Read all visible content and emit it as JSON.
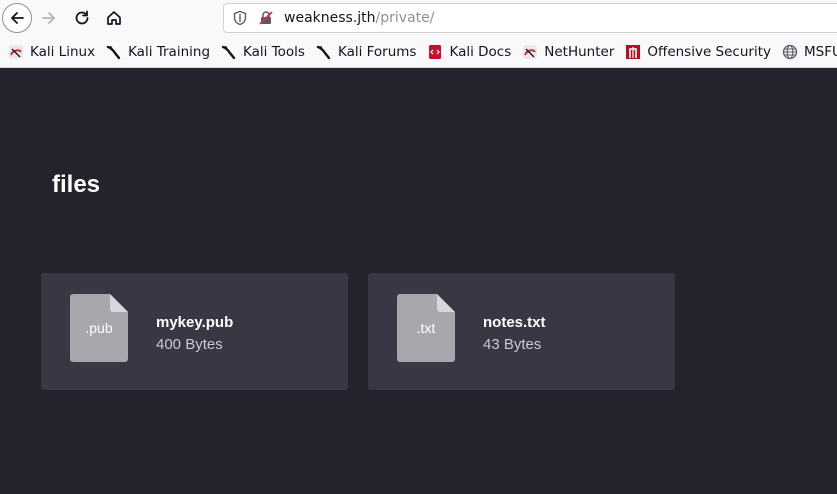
{
  "browser": {
    "url_host": "weakness.jth",
    "url_path": "/private/"
  },
  "bookmarks": [
    {
      "label": "Kali Linux",
      "icon": "kali-linux-icon"
    },
    {
      "label": "Kali Training",
      "icon": "kali-dragon-icon"
    },
    {
      "label": "Kali Tools",
      "icon": "kali-dragon-icon"
    },
    {
      "label": "Kali Forums",
      "icon": "kali-dragon-icon"
    },
    {
      "label": "Kali Docs",
      "icon": "kali-docs-icon"
    },
    {
      "label": "NetHunter",
      "icon": "nethunter-icon"
    },
    {
      "label": "Offensive Security",
      "icon": "offsec-icon"
    },
    {
      "label": "MSFU",
      "icon": "globe-icon"
    }
  ],
  "page": {
    "title": "files",
    "files": [
      {
        "ext": ".pub",
        "name": "mykey.pub",
        "size": "400 Bytes"
      },
      {
        "ext": ".txt",
        "name": "notes.txt",
        "size": "43 Bytes"
      }
    ]
  },
  "colors": {
    "page_background": "#23232e",
    "card_background": "#383845",
    "file_icon": "#a7a7ae"
  }
}
